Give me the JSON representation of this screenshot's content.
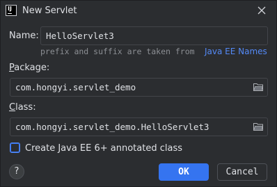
{
  "window": {
    "title": "New Servlet",
    "app_icon_text": "IJ"
  },
  "name_field": {
    "label": "Name:",
    "value": "HelloServlet3"
  },
  "hint": {
    "text": "prefix and suffix are taken from",
    "link": "Java EE Names"
  },
  "package_field": {
    "label_mnemonic": "P",
    "label_rest": "ackage:",
    "value": "com.hongyi.servlet_demo"
  },
  "class_field": {
    "label_mnemonic": "C",
    "label_rest": "lass:",
    "value": "com.hongyi.servlet_demo.HelloServlet3"
  },
  "annotated_checkbox": {
    "label": "Create Java EE 6+ annotated class",
    "checked": false
  },
  "buttons": {
    "help": "?",
    "ok": "OK",
    "cancel": "Cancel"
  },
  "colors": {
    "background": "#2b2d30",
    "accent": "#3574f0",
    "link": "#548af7",
    "text": "#dfe1e5",
    "hint": "#8c8f94"
  },
  "icons": {
    "folder": "folder-icon",
    "close": "close-icon"
  }
}
